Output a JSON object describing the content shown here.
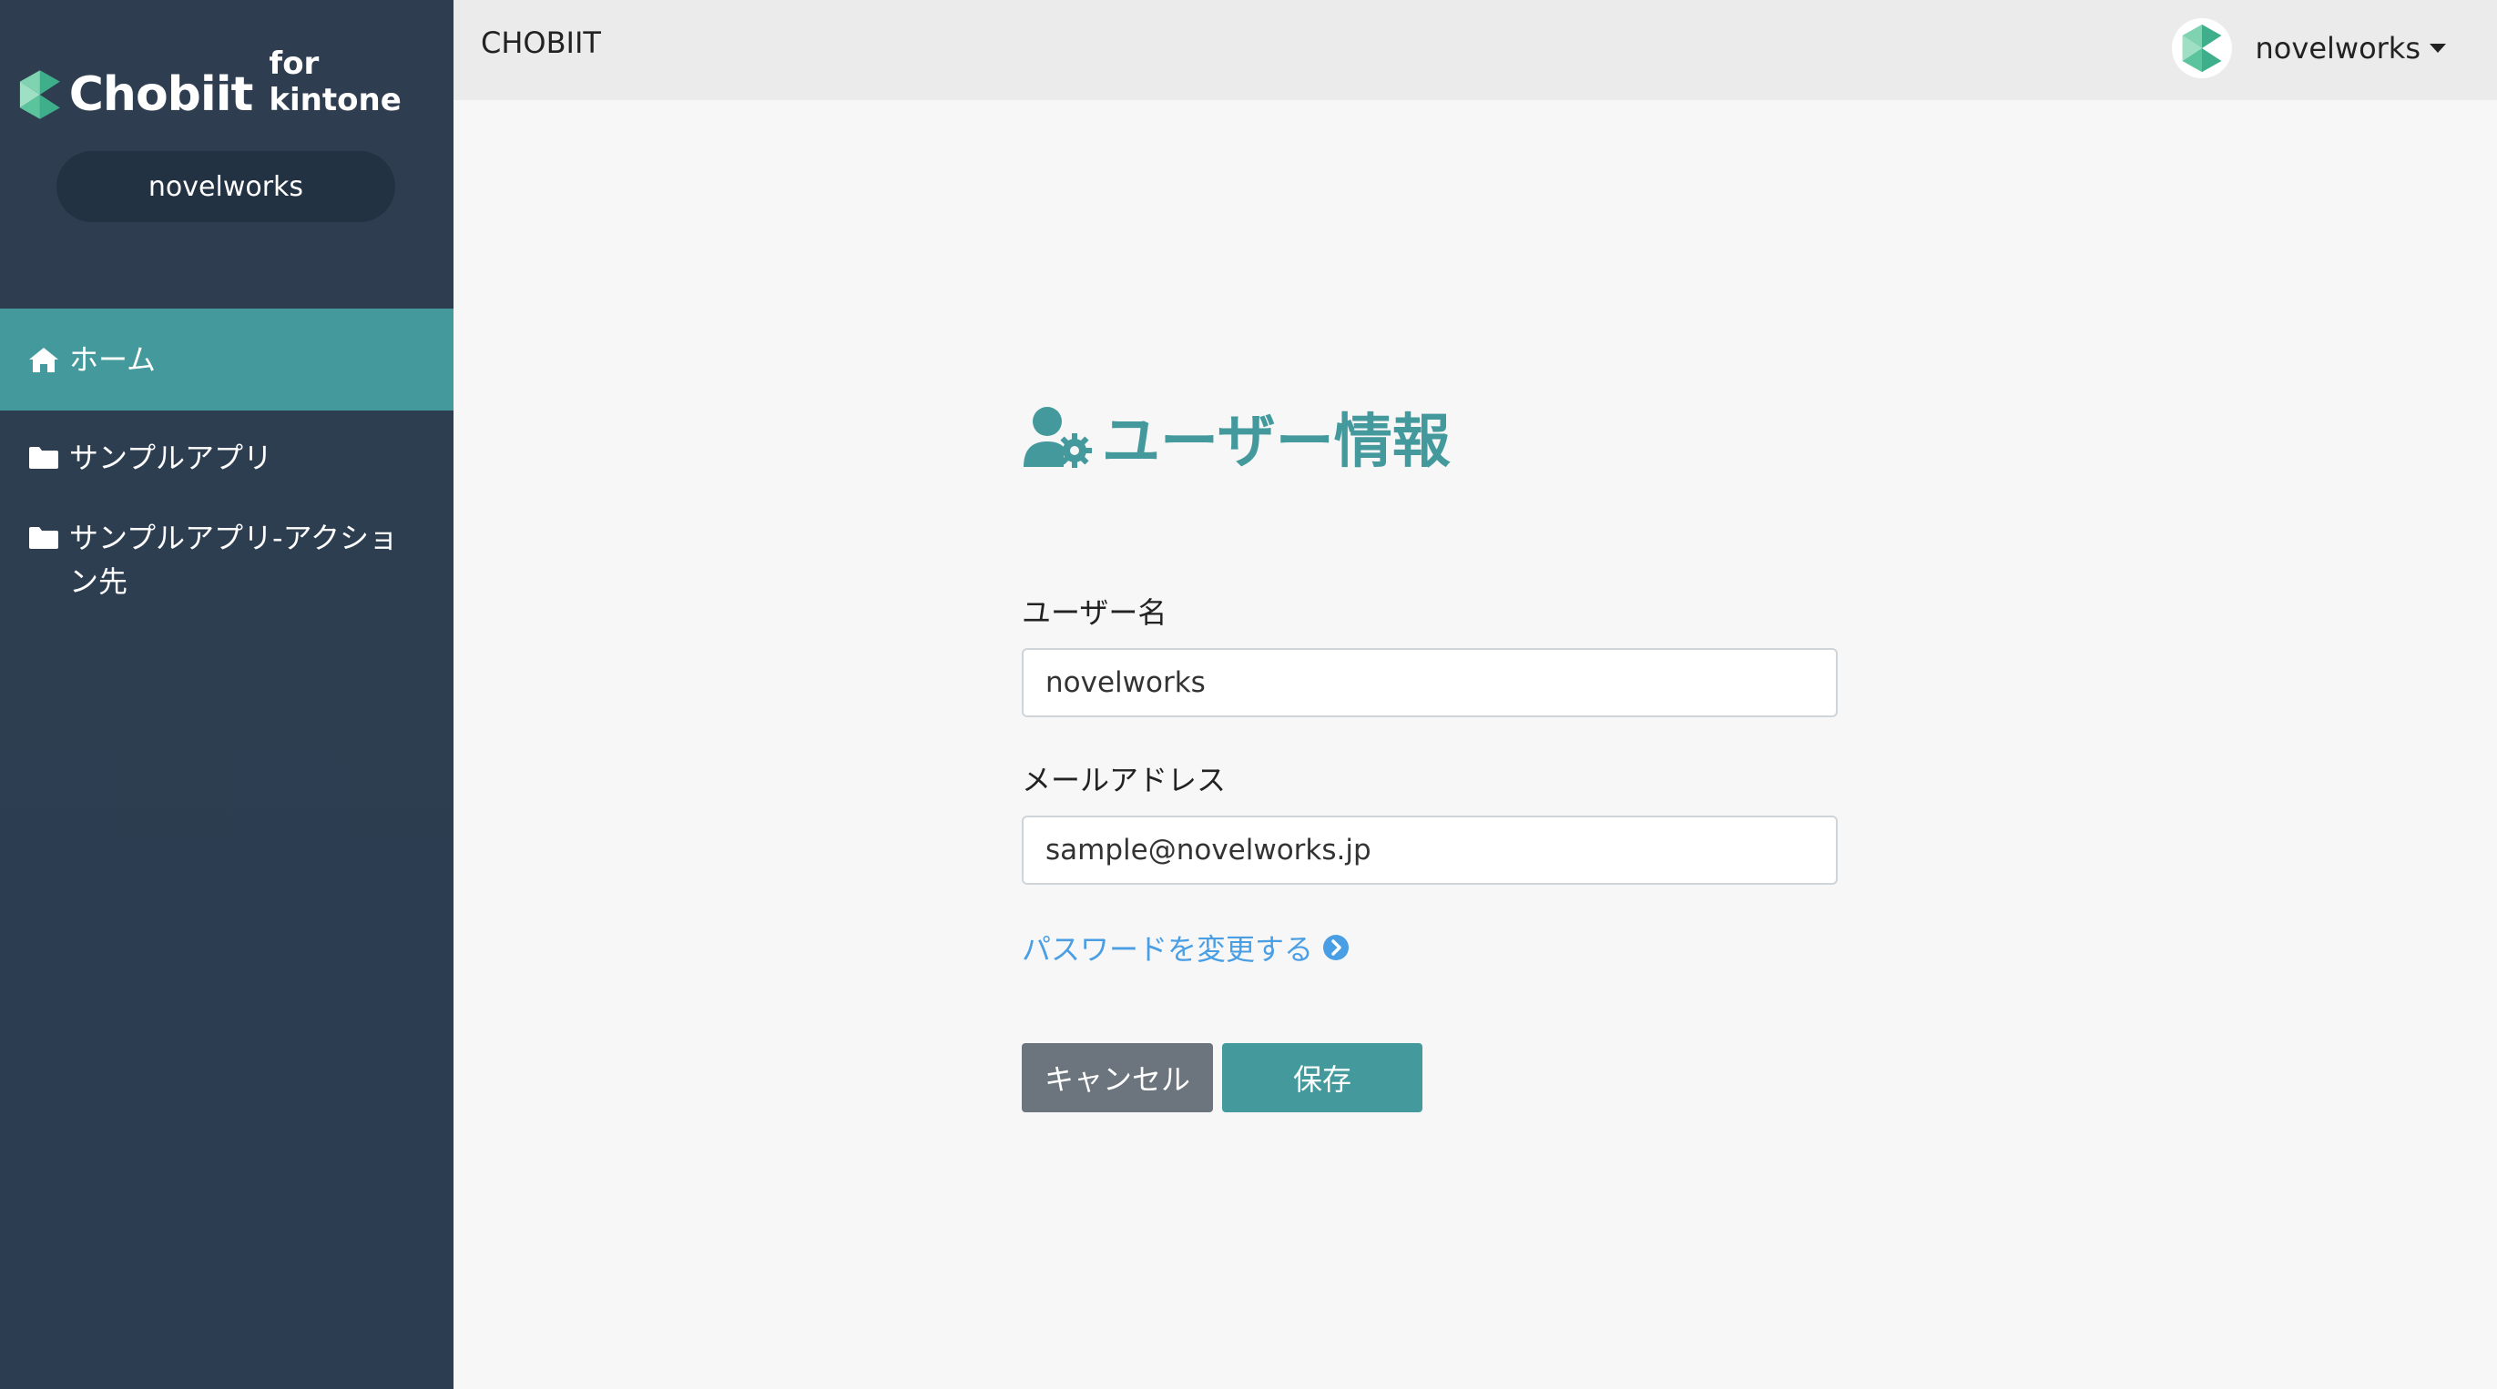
{
  "sidebar": {
    "logo_word": "Chobiit",
    "logo_sub": "for kintone",
    "account": "novelworks",
    "items": [
      {
        "label": "ホーム",
        "icon": "home-icon",
        "active": true
      },
      {
        "label": "サンプルアプリ",
        "icon": "folder-icon",
        "active": false
      },
      {
        "label": "サンプルアプリ-アクション先",
        "icon": "folder-icon",
        "active": false
      }
    ]
  },
  "header": {
    "brand": "CHOBIIT",
    "user": "novelworks"
  },
  "main": {
    "title": "ユーザー情報",
    "username_label": "ユーザー名",
    "username_value": "novelworks",
    "email_label": "メールアドレス",
    "email_value": "sample@novelworks.jp",
    "change_password": "パスワードを変更する",
    "cancel_label": "キャンセル",
    "save_label": "保存"
  },
  "colors": {
    "sidebar_bg": "#2e3e50",
    "accent": "#43999b",
    "link": "#4a9ee3",
    "cancel": "#6c757d"
  }
}
